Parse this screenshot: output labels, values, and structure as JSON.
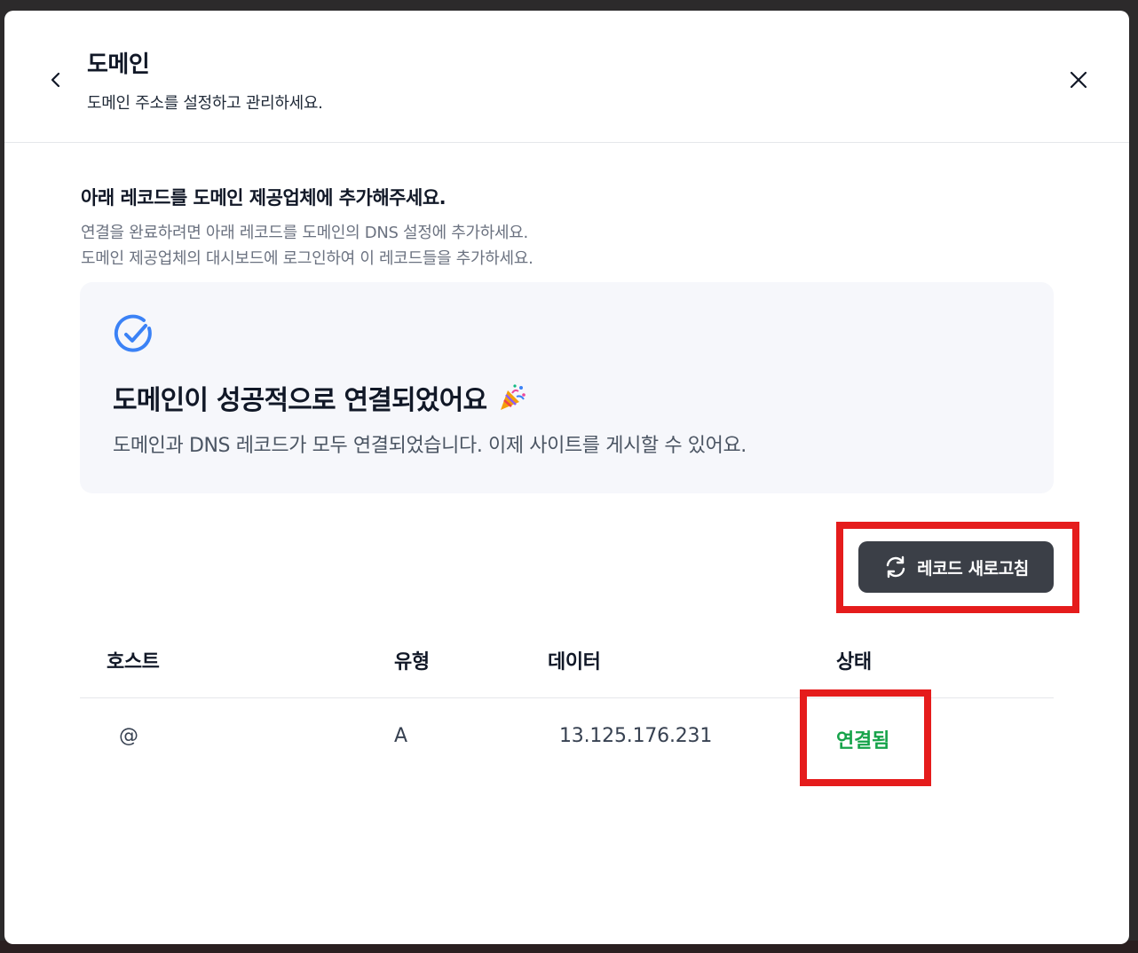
{
  "header": {
    "title": "도메인",
    "subtitle": "도메인 주소를 설정하고 관리하세요."
  },
  "instructions": {
    "title": "아래 레코드를 도메인 제공업체에 추가해주세요.",
    "desc_line1": "연결을 완료하려면 아래 레코드를 도메인의 DNS 설정에 추가하세요.",
    "desc_line2": "도메인 제공업체의 대시보드에 로그인하여 이 레코드들을 추가하세요."
  },
  "success": {
    "title": "도메인이 성공적으로 연결되었어요",
    "desc": "도메인과 DNS 레코드가 모두 연결되었습니다. 이제 사이트를 게시할 수 있어요.",
    "icon": "check-circle-icon",
    "emoji_icon": "party-popper-icon"
  },
  "actions": {
    "refresh_label": "레코드 새로고침"
  },
  "table": {
    "columns": [
      "호스트",
      "유형",
      "데이터",
      "상태"
    ],
    "rows": [
      {
        "host": "@",
        "type": "A",
        "data": "13.125.176.231",
        "status": "연결됨"
      }
    ]
  },
  "colors": {
    "accent_blue": "#3b82f6",
    "status_green": "#16a34a",
    "highlight_red": "#e51c1c",
    "button_dark": "#3b3f47"
  }
}
